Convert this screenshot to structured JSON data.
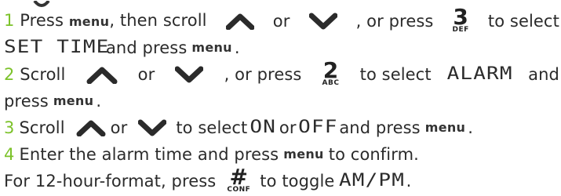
{
  "header_partial": "display",
  "colors": {
    "step_number": "#7cc22a",
    "text": "#2b2b2b"
  },
  "steps": [
    {
      "number": "1",
      "text_a": "Press",
      "menu_key": "menu",
      "text_b": ", then scroll",
      "or_1": "or",
      "text_c": ", or press",
      "key": {
        "big": "3",
        "small": "DEF"
      },
      "text_d": "to select",
      "display_word": "SET TIME",
      "text_e": "and press",
      "menu_key_2": "menu",
      "end": "."
    },
    {
      "number": "2",
      "text_a": "Scroll",
      "or_1": "or",
      "text_b": ", or press",
      "key": {
        "big": "2",
        "small": "ABC"
      },
      "text_c": "to select",
      "display_word": "ALARM",
      "text_d": "and",
      "text_e": "press",
      "menu_key": "menu",
      "end": "."
    },
    {
      "number": "3",
      "text_a": "Scroll",
      "or_1": "or",
      "text_b": "to select",
      "display_on": "ON",
      "or_2": "or",
      "display_off": "OFF",
      "text_c": "and press",
      "menu_key": "menu",
      "end": "."
    },
    {
      "number": "4",
      "text_a": "Enter the alarm time and press",
      "menu_key": "menu",
      "text_b": "to confirm."
    }
  ],
  "note": {
    "text_a": "For 12-hour-format, press",
    "key": {
      "big": "#",
      "small": "CONF"
    },
    "text_b": "to toggle",
    "display_word": "AM/PM",
    "end": "."
  }
}
